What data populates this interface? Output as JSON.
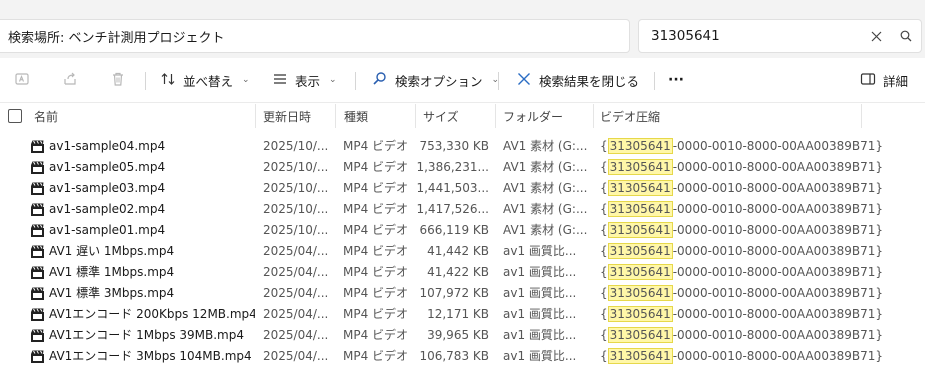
{
  "address": {
    "text": "検索場所: ベンチ計測用プロジェクト"
  },
  "search": {
    "value": "31305641"
  },
  "toolbar": {
    "sort_label": "並べ替え",
    "view_label": "表示",
    "search_options_label": "検索オプション",
    "close_search_label": "検索結果を閉じる",
    "more_label": "···",
    "details_label": "詳細"
  },
  "columns": {
    "name": "名前",
    "date": "更新日時",
    "type": "種類",
    "size": "サイズ",
    "folder": "フォルダー",
    "codec": "ビデオ圧縮"
  },
  "files": [
    {
      "name": "av1-sample04.mp4",
      "date": "2025/10/...",
      "type": "MP4 ビデオ",
      "size": "753,330 KB",
      "folder": "AV1 素材 (G:...",
      "codec_pre": "{",
      "codec_match": "31305641",
      "codec_post": "-0000-0010-8000-00AA00389B71}"
    },
    {
      "name": "av1-sample05.mp4",
      "date": "2025/10/...",
      "type": "MP4 ビデオ",
      "size": "1,386,231...",
      "folder": "AV1 素材 (G:...",
      "codec_pre": "{",
      "codec_match": "31305641",
      "codec_post": "-0000-0010-8000-00AA00389B71}"
    },
    {
      "name": "av1-sample03.mp4",
      "date": "2025/10/...",
      "type": "MP4 ビデオ",
      "size": "1,441,503...",
      "folder": "AV1 素材 (G:...",
      "codec_pre": "{",
      "codec_match": "31305641",
      "codec_post": "-0000-0010-8000-00AA00389B71}"
    },
    {
      "name": "av1-sample02.mp4",
      "date": "2025/10/...",
      "type": "MP4 ビデオ",
      "size": "1,417,526...",
      "folder": "AV1 素材 (G:...",
      "codec_pre": "{",
      "codec_match": "31305641",
      "codec_post": "-0000-0010-8000-00AA00389B71}"
    },
    {
      "name": "av1-sample01.mp4",
      "date": "2025/10/...",
      "type": "MP4 ビデオ",
      "size": "666,119 KB",
      "folder": "AV1 素材 (G:...",
      "codec_pre": "{",
      "codec_match": "31305641",
      "codec_post": "-0000-0010-8000-00AA00389B71}"
    },
    {
      "name": "AV1 遅い 1Mbps.mp4",
      "date": "2025/04/...",
      "type": "MP4 ビデオ",
      "size": "41,442 KB",
      "folder": "av1 画質比...",
      "codec_pre": "{",
      "codec_match": "31305641",
      "codec_post": "-0000-0010-8000-00AA00389B71}"
    },
    {
      "name": "AV1 標準 1Mbps.mp4",
      "date": "2025/04/...",
      "type": "MP4 ビデオ",
      "size": "41,422 KB",
      "folder": "av1 画質比...",
      "codec_pre": "{",
      "codec_match": "31305641",
      "codec_post": "-0000-0010-8000-00AA00389B71}"
    },
    {
      "name": "AV1 標準 3Mbps.mp4",
      "date": "2025/04/...",
      "type": "MP4 ビデオ",
      "size": "107,972 KB",
      "folder": "av1 画質比...",
      "codec_pre": "{",
      "codec_match": "31305641",
      "codec_post": "-0000-0010-8000-00AA00389B71}"
    },
    {
      "name": "AV1エンコード 200Kbps 12MB.mp4",
      "date": "2025/04/...",
      "type": "MP4 ビデオ",
      "size": "12,171 KB",
      "folder": "av1 画質比...",
      "codec_pre": "{",
      "codec_match": "31305641",
      "codec_post": "-0000-0010-8000-00AA00389B71}"
    },
    {
      "name": "AV1エンコード 1Mbps 39MB.mp4",
      "date": "2025/04/...",
      "type": "MP4 ビデオ",
      "size": "39,965 KB",
      "folder": "av1 画質比...",
      "codec_pre": "{",
      "codec_match": "31305641",
      "codec_post": "-0000-0010-8000-00AA00389B71}"
    },
    {
      "name": "AV1エンコード 3Mbps 104MB.mp4",
      "date": "2025/04/...",
      "type": "MP4 ビデオ",
      "size": "106,783 KB",
      "folder": "av1 画質比...",
      "codec_pre": "{",
      "codec_match": "31305641",
      "codec_post": "-0000-0010-8000-00AA00389B71}"
    }
  ]
}
